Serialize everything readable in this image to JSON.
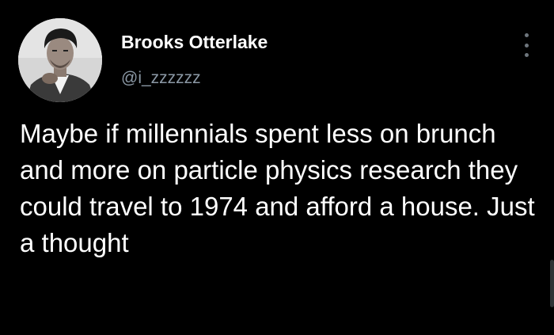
{
  "tweet": {
    "author": {
      "display_name": "Brooks Otterlake",
      "handle": "@i_zzzzzz",
      "avatar": "profile-photo"
    },
    "menu_icon": "more-vertical-icon",
    "text": "Maybe if millennials spent less on brunch and more on particle physics research they could travel to 1974 and afford a house. Just a thought"
  },
  "colors": {
    "background": "#000000",
    "text": "#ffffff",
    "handle": "#8b98a5",
    "icon": "#6e767d"
  }
}
